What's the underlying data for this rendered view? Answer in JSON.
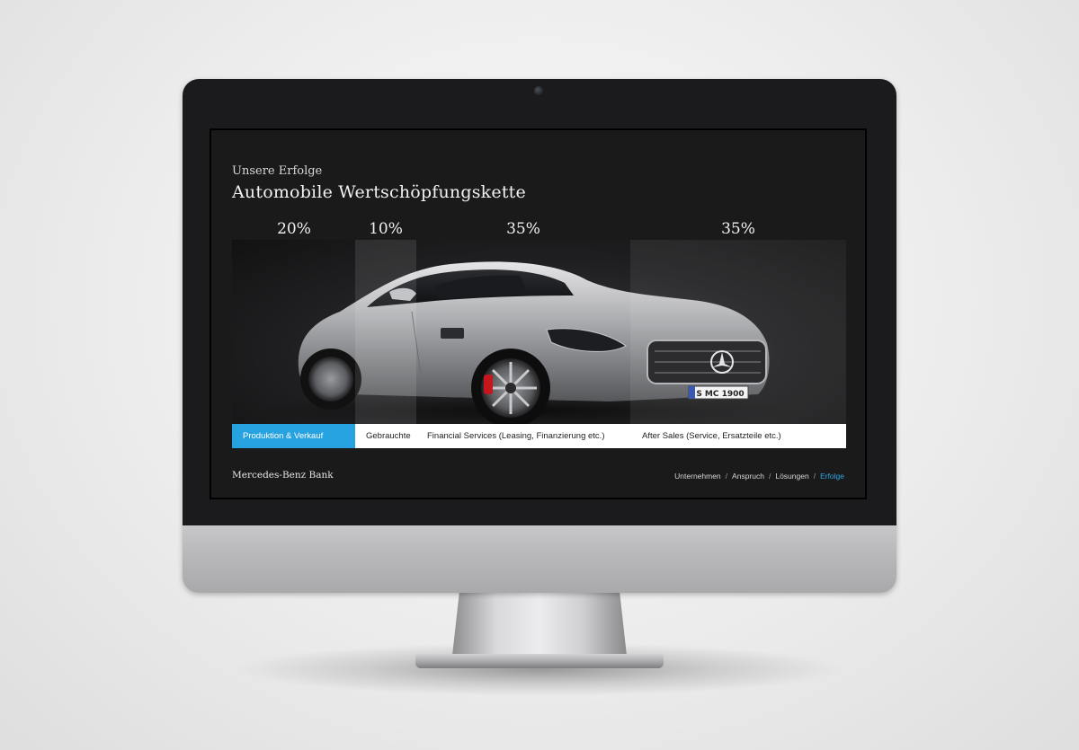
{
  "header": {
    "subtitle": "Unsere Erfolge",
    "title": "Automobile Wertschöpfungskette"
  },
  "chart_data": {
    "type": "bar",
    "categories": [
      "Produktion & Verkauf",
      "Gebrauchte",
      "Financial Services (Leasing, Finanzierung etc.)",
      "After Sales (Service, Ersatzteile etc.)"
    ],
    "value_labels": [
      "20%",
      "10%",
      "35%",
      "35%"
    ],
    "values": [
      20,
      10,
      35,
      35
    ],
    "active_index": 0
  },
  "segments": [
    {
      "label": "Produktion & Verkauf",
      "pct": "20%"
    },
    {
      "label": "Gebrauchte",
      "pct": "10%"
    },
    {
      "label": "Financial Services (Leasing, Finanzierung etc.)",
      "pct": "35%"
    },
    {
      "label": "After Sales (Service, Ersatzteile etc.)",
      "pct": "35%"
    }
  ],
  "plate": "S MC 1900",
  "footer": {
    "brand": "Mercedes-Benz Bank",
    "nav": [
      "Unternehmen",
      "Anspruch",
      "Lösungen",
      "Erfolge"
    ],
    "separator": "/",
    "current": "Erfolge"
  },
  "colors": {
    "accent": "#27a2e0",
    "screen_bg": "#1a1a1a",
    "bezel": "#1b1b1d"
  }
}
